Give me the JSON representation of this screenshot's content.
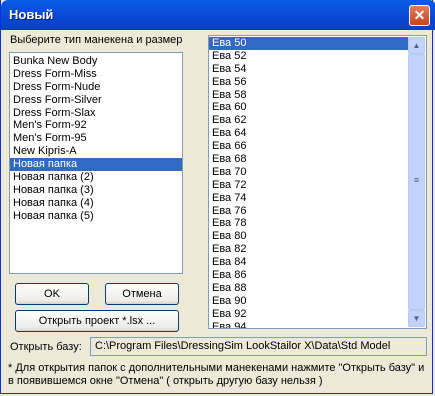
{
  "window": {
    "title": "Новый",
    "close_glyph": "✕"
  },
  "left_panel": {
    "header": "Выберите тип манекена и размер",
    "items": [
      {
        "label": "Bunka New Body",
        "selected": false
      },
      {
        "label": "Dress Form-Miss",
        "selected": false
      },
      {
        "label": "Dress Form-Nude",
        "selected": false
      },
      {
        "label": "Dress Form-Silver",
        "selected": false
      },
      {
        "label": "Dress Form-Slax",
        "selected": false
      },
      {
        "label": "Men's Form-92",
        "selected": false
      },
      {
        "label": "Men's Form-95",
        "selected": false
      },
      {
        "label": "New Kipris-A",
        "selected": false
      },
      {
        "label": "Новая папка",
        "selected": true
      },
      {
        "label": "Новая папка (2)",
        "selected": false
      },
      {
        "label": "Новая папка (3)",
        "selected": false
      },
      {
        "label": "Новая папка (4)",
        "selected": false
      },
      {
        "label": "Новая папка (5)",
        "selected": false
      }
    ]
  },
  "sizes": {
    "items": [
      {
        "label": "Ева 50",
        "selected": true
      },
      {
        "label": "Ева 52",
        "selected": false
      },
      {
        "label": "Ева 54",
        "selected": false
      },
      {
        "label": "Ева 56",
        "selected": false
      },
      {
        "label": "Ева 58",
        "selected": false
      },
      {
        "label": "Ева 60",
        "selected": false
      },
      {
        "label": "Ева 62",
        "selected": false
      },
      {
        "label": "Ева 64",
        "selected": false
      },
      {
        "label": "Ева 66",
        "selected": false
      },
      {
        "label": "Ева 68",
        "selected": false
      },
      {
        "label": "Ева 70",
        "selected": false
      },
      {
        "label": "Ева 72",
        "selected": false
      },
      {
        "label": "Ева 74",
        "selected": false
      },
      {
        "label": "Ева 76",
        "selected": false
      },
      {
        "label": "Ева 78",
        "selected": false
      },
      {
        "label": "Ева 80",
        "selected": false
      },
      {
        "label": "Ева 82",
        "selected": false
      },
      {
        "label": "Ева 84",
        "selected": false
      },
      {
        "label": "Ева 86",
        "selected": false
      },
      {
        "label": "Ева 88",
        "selected": false
      },
      {
        "label": "Ева 90",
        "selected": false
      },
      {
        "label": "Ева 92",
        "selected": false
      },
      {
        "label": "Ева 94",
        "selected": false
      }
    ],
    "scroll_up_glyph": "▲",
    "scroll_down_glyph": "▼",
    "thumb_glyph": "≡"
  },
  "buttons": {
    "ok": "OK",
    "cancel": "Отмена",
    "open_project": "Открыть проект *.lsx ..."
  },
  "open_base": {
    "label": "Открыть базу:",
    "path": "C:\\Program Files\\DressingSim LookStailor X\\Data\\Std Model"
  },
  "note": "* Для открытия папок с дополнительными манекенами нажмите \"Открыть базу\" и в появившемся окне \"Отмена\" ( открыть другую базу нельзя )"
}
